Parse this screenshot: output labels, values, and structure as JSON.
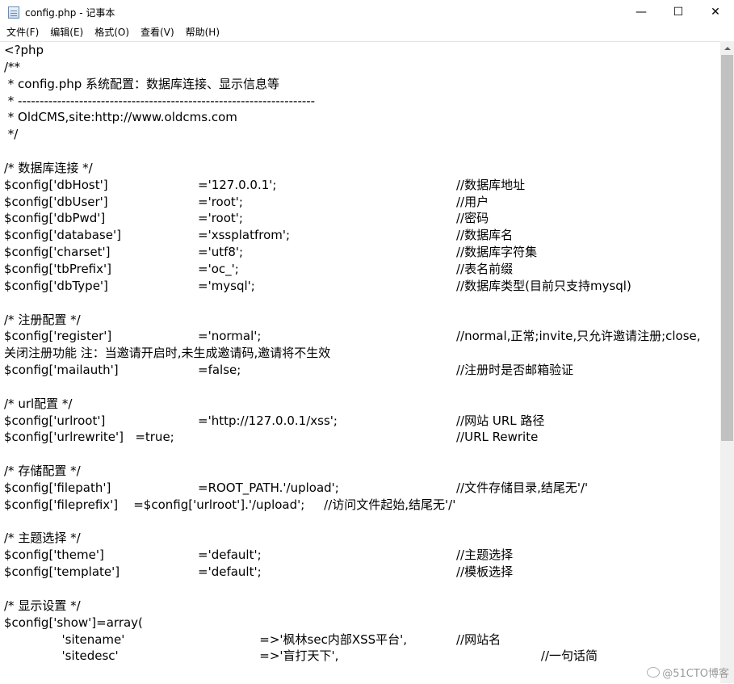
{
  "window": {
    "title": "config.php - 记事本",
    "icon": "notepad-icon",
    "controls": {
      "minimize": "—",
      "maximize": "☐",
      "close": "✕"
    }
  },
  "menu": [
    "文件(F)",
    "编辑(E)",
    "格式(O)",
    "查看(V)",
    "帮助(H)"
  ],
  "editor_lines": [
    {
      "a": "<?php",
      "b": "",
      "c": ""
    },
    {
      "a": "/**",
      "b": "",
      "c": ""
    },
    {
      "a": " * config.php 系统配置：数据库连接、显示信息等",
      "b": "",
      "c": ""
    },
    {
      "a": " * --------------------------------------------------------------------",
      "b": "",
      "c": ""
    },
    {
      "a": " * OldCMS,site:http://www.oldcms.com",
      "b": "",
      "c": ""
    },
    {
      "a": " */",
      "b": "",
      "c": ""
    },
    {
      "a": "",
      "b": "",
      "c": ""
    },
    {
      "a": "/* 数据库连接 */",
      "b": "",
      "c": ""
    },
    {
      "a": "$config['dbHost']",
      "b": "='127.0.0.1';",
      "c": "//数据库地址"
    },
    {
      "a": "$config['dbUser']",
      "b": "='root';",
      "c": "//用户"
    },
    {
      "a": "$config['dbPwd']",
      "b": "='root';",
      "c": "//密码"
    },
    {
      "a": "$config['database']",
      "b": "='xssplatfrom';",
      "c": "//数据库名"
    },
    {
      "a": "$config['charset']",
      "b": "='utf8';",
      "c": "//数据库字符集"
    },
    {
      "a": "$config['tbPrefix']",
      "b": "='oc_';",
      "c": "//表名前缀"
    },
    {
      "a": "$config['dbType']",
      "b": "='mysql';",
      "c": "//数据库类型(目前只支持mysql)"
    },
    {
      "a": "",
      "b": "",
      "c": ""
    },
    {
      "a": "/* 注册配置 */",
      "b": "",
      "c": ""
    },
    {
      "a": "$config['register']",
      "b": "='normal';",
      "c": "//normal,正常;invite,只允许邀请注册;close,"
    },
    {
      "a": "关闭注册功能 注：当邀请开启时,未生成邀请码,邀请将不生效",
      "b": "",
      "c": ""
    },
    {
      "a": "$config['mailauth']",
      "b": "=false;",
      "c": "//注册时是否邮箱验证"
    },
    {
      "a": "",
      "b": "",
      "c": ""
    },
    {
      "a": "/* url配置 */",
      "b": "",
      "c": ""
    },
    {
      "a": "$config['urlroot']",
      "b": "='http://127.0.0.1/xss';",
      "c": "//网站 URL 路径"
    },
    {
      "a": "$config['urlrewrite']   =true;",
      "b": "",
      "c": "//URL Rewrite"
    },
    {
      "a": "",
      "b": "",
      "c": ""
    },
    {
      "a": "/* 存储配置 */",
      "b": "",
      "c": ""
    },
    {
      "a": "$config['filepath']",
      "b": "=ROOT_PATH.'/upload';",
      "c": "//文件存储目录,结尾无'/'"
    },
    {
      "a": "$config['fileprefix']    =$config['urlroot'].'/upload';     //访问文件起始,结尾无'/'",
      "b": "",
      "c": ""
    },
    {
      "a": "",
      "b": "",
      "c": ""
    },
    {
      "a": "/* 主题选择 */",
      "b": "",
      "c": ""
    },
    {
      "a": "$config['theme']",
      "b": "='default';",
      "c": "//主题选择"
    },
    {
      "a": "$config['template']",
      "b": "='default';",
      "c": "//模板选择"
    },
    {
      "a": "",
      "b": "",
      "c": ""
    },
    {
      "a": "/* 显示设置 */",
      "b": "",
      "c": ""
    },
    {
      "a": "$config['show']=array(",
      "b": "",
      "c": ""
    },
    {
      "a": "               'sitename'",
      "b": "                =>'枫林sec内部XSS平台',",
      "c": "//网站名"
    },
    {
      "a": "               'sitedesc'",
      "b": "                =>'盲打天下',",
      "c": "                      //一句话简"
    }
  ],
  "watermark": "@51CTO博客"
}
